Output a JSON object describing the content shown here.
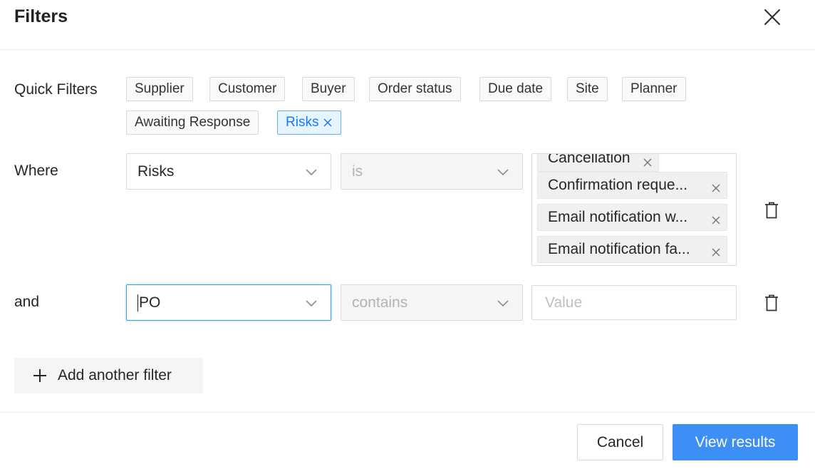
{
  "dialog": {
    "title": "Filters",
    "close_icon": "close-icon"
  },
  "quick_filters": {
    "label": "Quick Filters",
    "chips": [
      {
        "label": "Supplier",
        "active": false
      },
      {
        "label": "Customer",
        "active": false
      },
      {
        "label": "Buyer",
        "active": false
      },
      {
        "label": "Order status",
        "active": false
      },
      {
        "label": "Due date",
        "active": false
      },
      {
        "label": "Site",
        "active": false
      },
      {
        "label": "Planner",
        "active": false
      },
      {
        "label": "Awaiting Response",
        "active": false
      },
      {
        "label": "Risks",
        "active": true
      }
    ]
  },
  "filters": [
    {
      "conjunction": "Where",
      "field": "Risks",
      "operator": "is",
      "values": [
        "Cancellation",
        "Confirmation reque...",
        "Email notification w...",
        "Email notification fa..."
      ]
    },
    {
      "conjunction": "and",
      "field": "PO",
      "operator": "contains",
      "value": "",
      "value_placeholder": "Value"
    }
  ],
  "actions": {
    "add_filter_label": "Add another filter",
    "cancel_label": "Cancel",
    "submit_label": "View results"
  },
  "colors": {
    "primary": "#3d8ff5",
    "active_chip_bg": "#e6f4ff",
    "active_chip_text": "#1677ff"
  }
}
